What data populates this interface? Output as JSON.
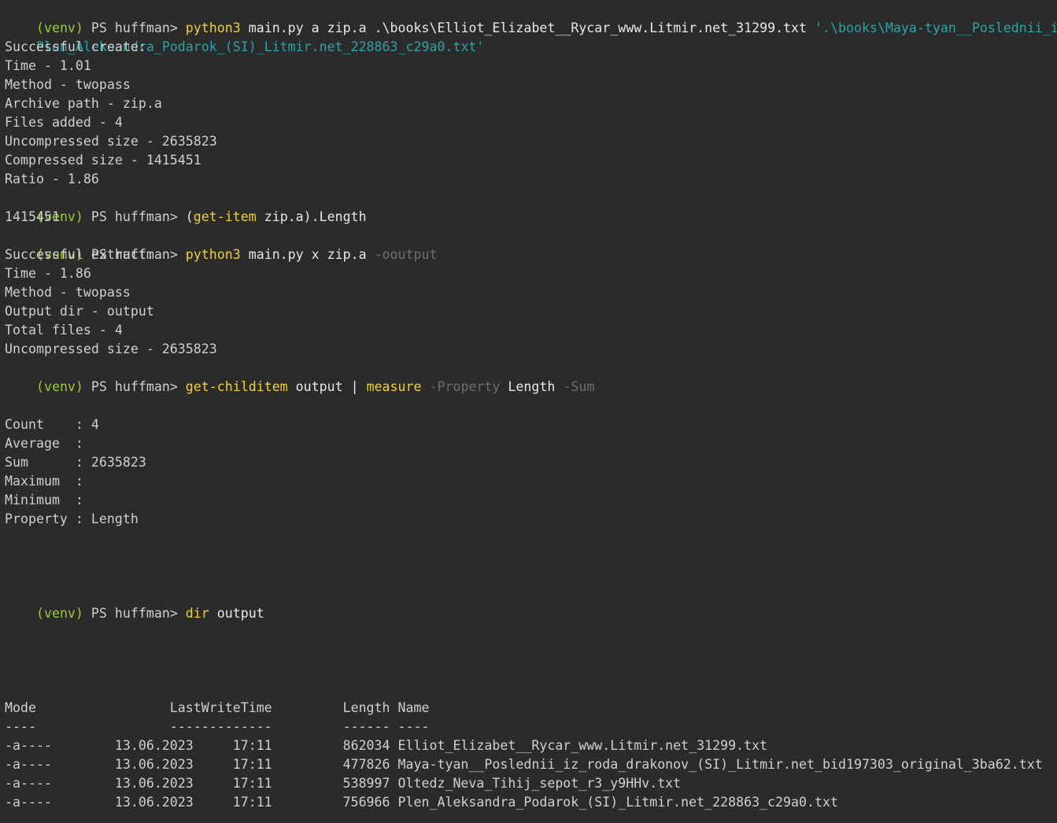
{
  "prompt": {
    "venv": "(venv)",
    "ps": " PS huffman> "
  },
  "commands": {
    "create": {
      "cmd": "python3",
      "args": " main.py a zip.a .\\books\\Elliot_Elizabet__Rycar_www.Litmir.net_31299.txt ",
      "str_part1": "'.\\books\\Maya-tyan__Poslednii_iz_ro",
      "str_part2": "Plen_Aleksandra_Podarok_(SI)_Litmir.net_228863_c29a0.txt'"
    },
    "getitem": {
      "open": "(",
      "cmd": "get-item",
      "args": " zip.a).Length"
    },
    "extract": {
      "cmd": "python3",
      "args": " main.py x zip.a ",
      "param": "-ooutput"
    },
    "measure": {
      "cmd1": "get-childitem",
      "args1": " output | ",
      "cmd2": "measure",
      "param1": " -Property",
      "args2": " Length ",
      "param2": "-Sum"
    },
    "dir": {
      "cmd": "dir",
      "args": " output"
    }
  },
  "create_output": [
    "Successful create:",
    "Time - 1.01",
    "Method - twopass",
    "Archive path - zip.a",
    "Files added - 4",
    "Uncompressed size - 2635823",
    "Compressed size - 1415451",
    "Ratio - 1.86"
  ],
  "getitem_output": "1415451",
  "extract_output": [
    "Successful extract:",
    "Time - 1.86",
    "Method - twopass",
    "Output dir - output",
    "Total files - 4",
    "Uncompressed size - 2635823"
  ],
  "measure_output": [
    "Count    : 4",
    "Average  :",
    "Sum      : 2635823",
    "Maximum  :",
    "Minimum  :",
    "Property : Length"
  ],
  "dir_table": {
    "header": "Mode                 LastWriteTime         Length Name",
    "separator": "----                 -------------         ------ ----",
    "rows": [
      "-a----        13.06.2023     17:11         862034 Elliot_Elizabet__Rycar_www.Litmir.net_31299.txt",
      "-a----        13.06.2023     17:11         477826 Maya-tyan__Poslednii_iz_roda_drakonov_(SI)_Litmir.net_bid197303_original_3ba62.txt",
      "-a----        13.06.2023     17:11         538997 Oltedz_Neva_Tihij_sepot_r3_y9HHv.txt",
      "-a----        13.06.2023     17:11         756966 Plen_Aleksandra_Podarok_(SI)_Litmir.net_228863_c29a0.txt"
    ]
  },
  "colors": {
    "background": "#2b2b2b",
    "foreground": "#d0d0d0",
    "venv": "#9acd32",
    "command": "#f0d030",
    "string": "#2aa5a5",
    "parameter": "#6e6e6e"
  }
}
